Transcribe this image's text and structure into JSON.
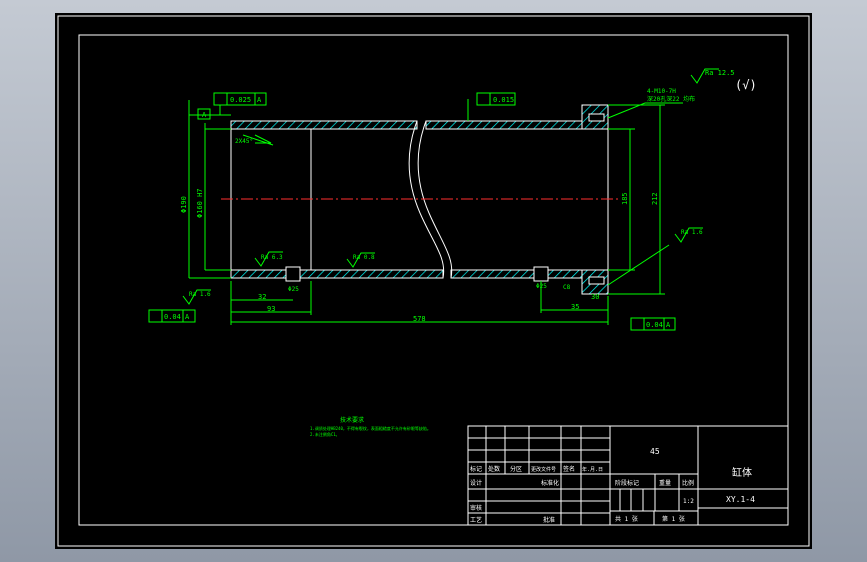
{
  "drawing": {
    "surface_finish_general": "Ra 12.5",
    "surface_finish_paren": "(√)",
    "flatness_tol": "0.025",
    "flatness_ref": "A",
    "runout_top_tol": "0.015",
    "thread_note_line1": "4-M10-7H",
    "thread_note_line2": "深20孔深22 均布",
    "chamfer_note": "2X45°",
    "ra_left_bore": "Ra 6.3",
    "ra_mid_bore": "Ra 0.8",
    "ra_bottom_left": "Ra 1.6",
    "ra_right_end": "Ra 1.6",
    "dim_outer_dia": "Φ190",
    "dim_inner_dia": "Φ160 H7",
    "dim_right_inner": "185",
    "dim_right_outer": "212",
    "dim_left_hole": "Φ25",
    "dim_right_hole": "Φ25",
    "dim_32": "32",
    "dim_93": "93",
    "dim_578": "578",
    "dim_35": "35",
    "dim_30": "30",
    "dim_c8": "C8",
    "datum_a": "A",
    "runout_left_tol": "0.04",
    "runout_left_ref": "A",
    "runout_right_tol": "0.04",
    "runout_right_ref": "A",
    "tech_req_title": "技术要求",
    "tech_req_line1": "1.调质处理HB240，不得有裂纹，表面粗糙度不允许有砂眼等缺陷。",
    "tech_req_line2": "2.未注倒角C1。"
  },
  "title_block": {
    "material": "45",
    "part_name": "缸体",
    "drawing_no": "XY.1-4",
    "scale": "1:2",
    "hdr_mark": "标记",
    "hdr_count": "处数",
    "hdr_zone": "分区",
    "hdr_doc": "更改文件号",
    "hdr_sign": "签名",
    "hdr_date": "年.月.日",
    "design": "设计",
    "standard": "标准化",
    "review": "审核",
    "process": "工艺",
    "approve": "批准",
    "stage_mark": "阶段标记",
    "weight": "重量",
    "scale_label": "比例",
    "total_sheets": "共 1 张",
    "sheet_no": "第 1 张"
  }
}
